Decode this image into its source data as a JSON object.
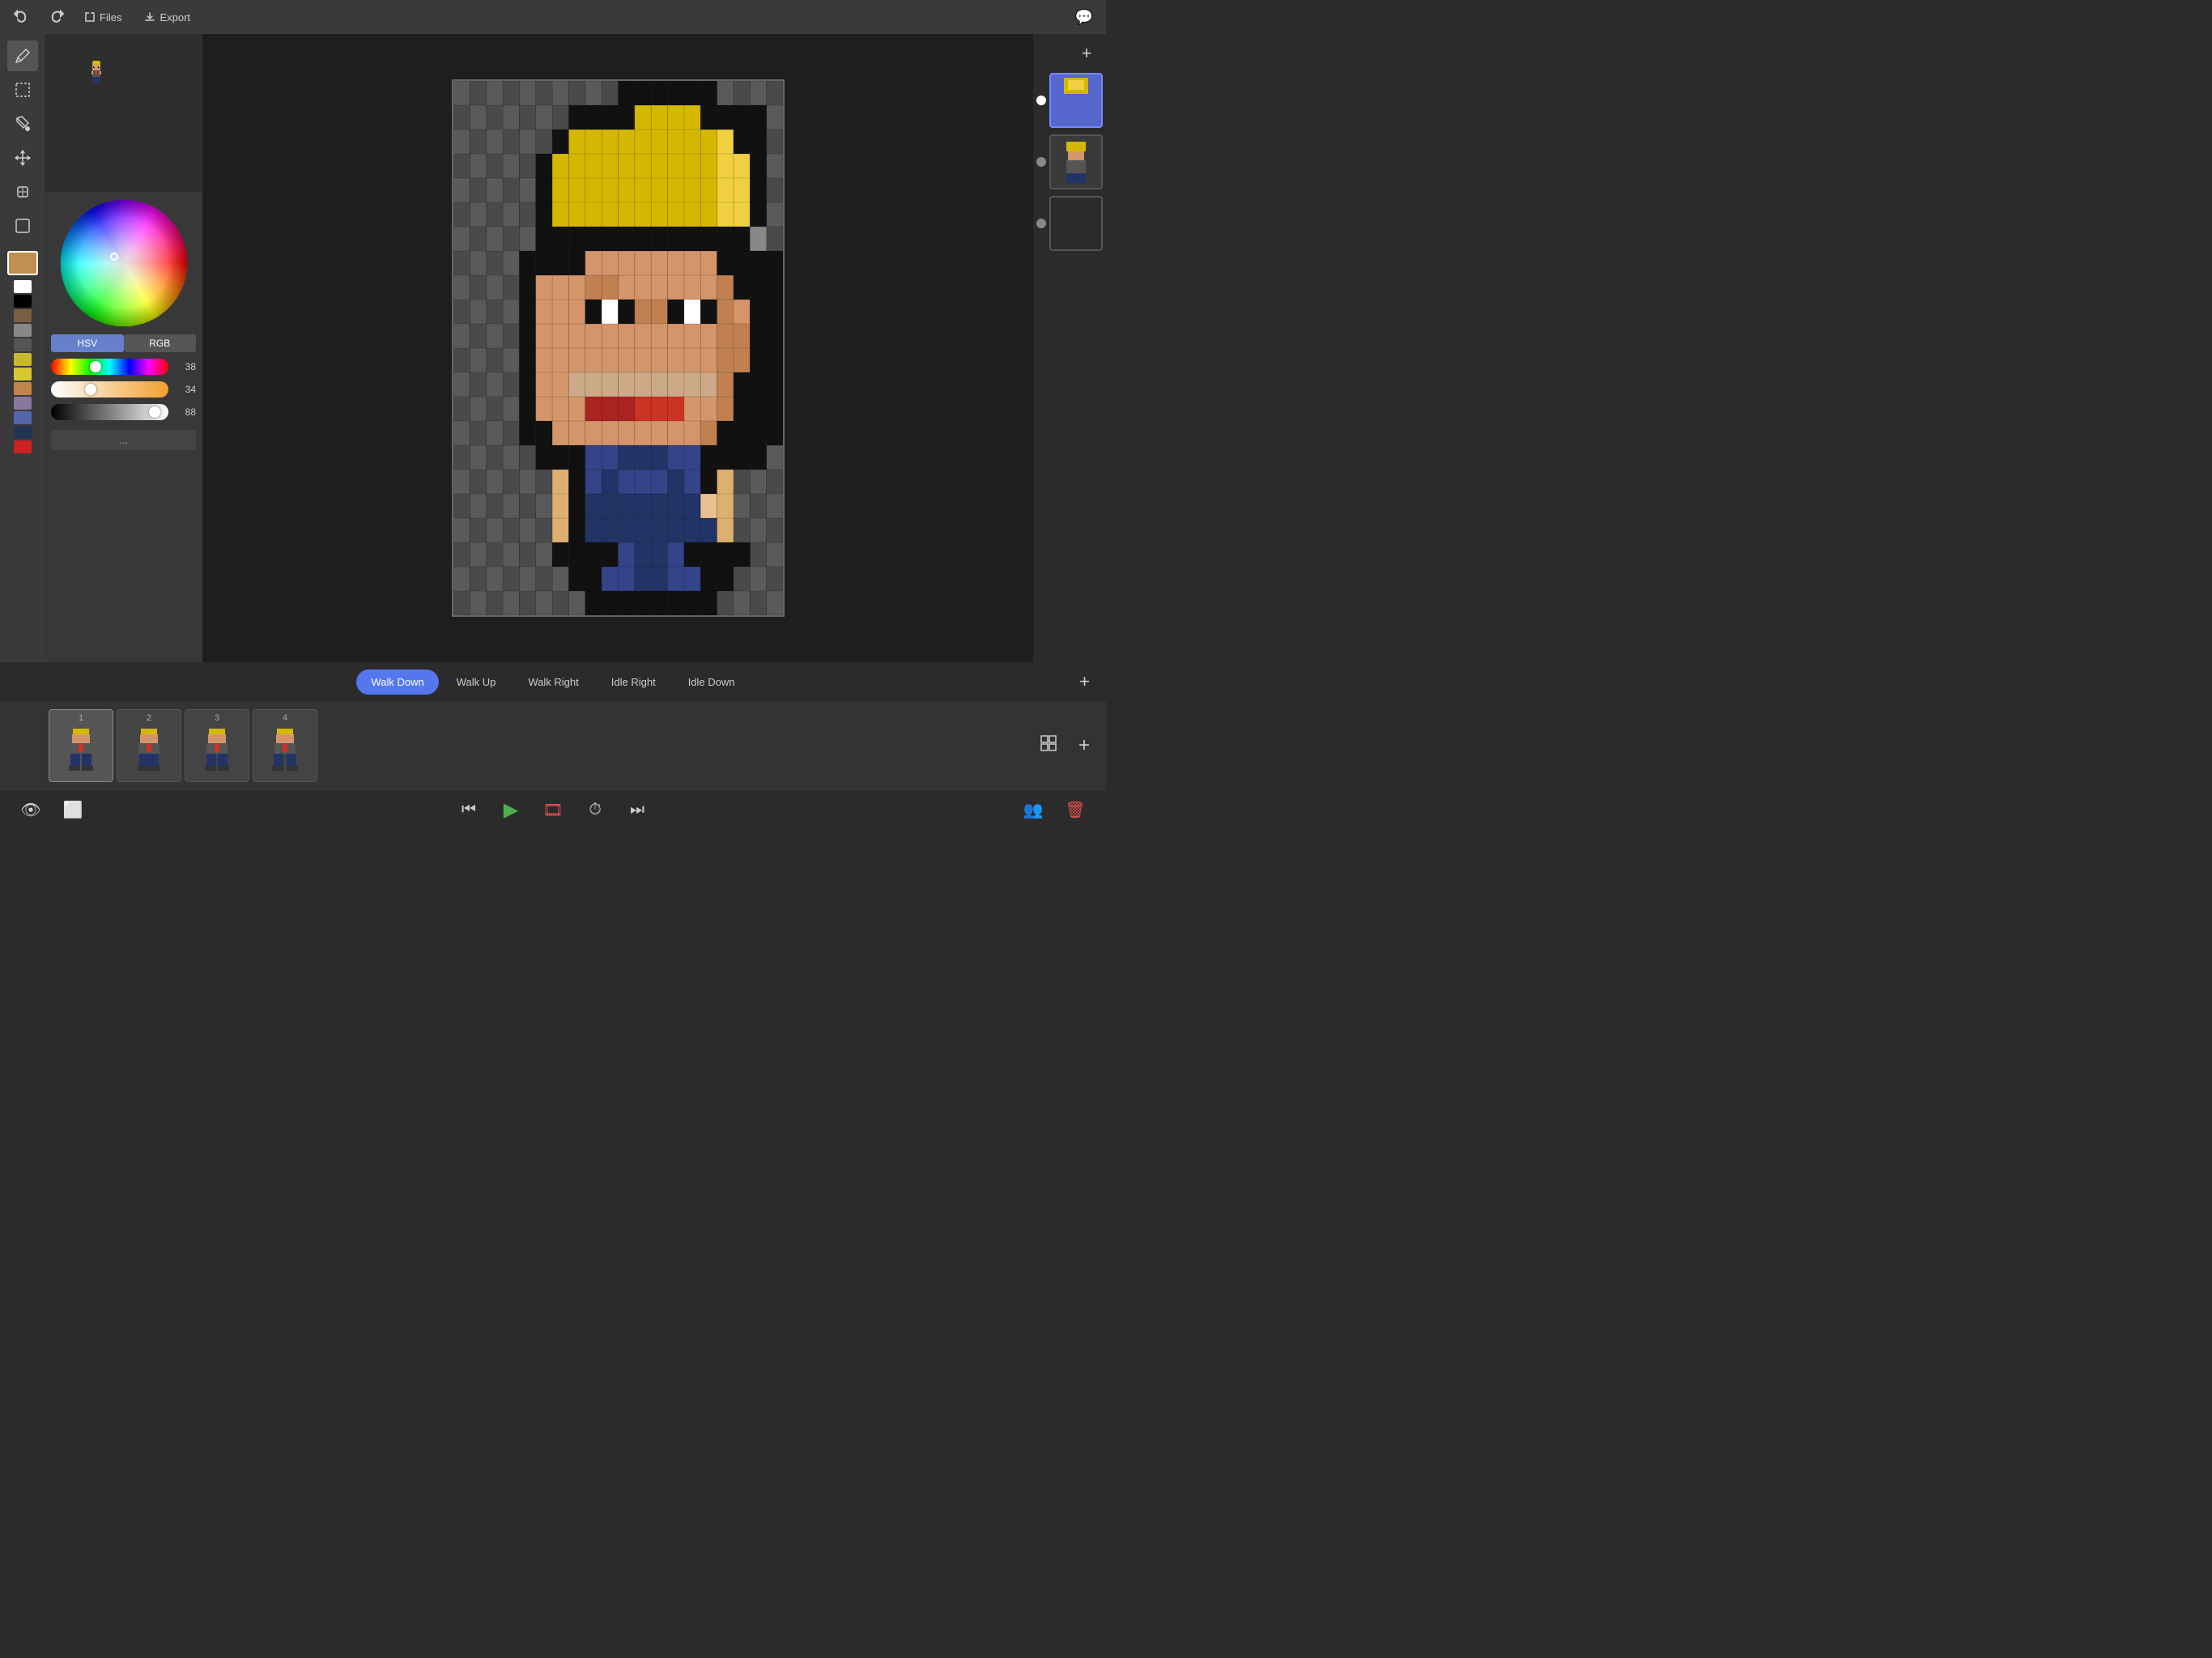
{
  "topBar": {
    "undoLabel": "↩",
    "redoLabel": "↪",
    "filesLabel": "Files",
    "exportLabel": "Export",
    "chatIcon": "💬",
    "addIcon": "+"
  },
  "tools": [
    {
      "name": "pencil",
      "icon": "✏️"
    },
    {
      "name": "select-rect",
      "icon": "▭"
    },
    {
      "name": "fill",
      "icon": "🪣"
    },
    {
      "name": "move",
      "icon": "✥"
    },
    {
      "name": "stamp",
      "icon": "⬡"
    },
    {
      "name": "select-lasso",
      "icon": "⬜"
    }
  ],
  "colorSwatches": [
    {
      "color": "#ffffff",
      "label": "white"
    },
    {
      "color": "#000000",
      "label": "black"
    },
    {
      "color": "#7a6040",
      "label": "brown"
    },
    {
      "color": "#888888",
      "label": "gray-mid"
    },
    {
      "color": "#555555",
      "label": "gray-dark"
    },
    {
      "color": "#c8b830",
      "label": "yellow-gold"
    },
    {
      "color": "#d8c830",
      "label": "yellow"
    },
    {
      "color": "#c0854a",
      "label": "tan"
    },
    {
      "color": "#8878a0",
      "label": "purple-gray"
    },
    {
      "color": "#5566aa",
      "label": "blue"
    },
    {
      "color": "#223355",
      "label": "navy"
    },
    {
      "color": "#cc2222",
      "label": "red"
    }
  ],
  "activeColor": "#c09050",
  "hsv": {
    "h": 38,
    "s": 34,
    "v": 88
  },
  "colorMode": "HSV",
  "animTabs": [
    {
      "label": "Walk Down",
      "active": true
    },
    {
      "label": "Walk Up",
      "active": false
    },
    {
      "label": "Walk Right",
      "active": false
    },
    {
      "label": "Idle Right",
      "active": false
    },
    {
      "label": "Idle Down",
      "active": false
    }
  ],
  "frames": [
    {
      "number": "1",
      "active": true
    },
    {
      "number": "2",
      "active": false
    },
    {
      "number": "3",
      "active": false
    },
    {
      "number": "4",
      "active": false
    }
  ],
  "layers": [
    {
      "active": true,
      "radio": true
    },
    {
      "active": false,
      "radio": false
    },
    {
      "active": false,
      "radio": false
    }
  ],
  "bottomBar": {
    "eyeIcon": "👁",
    "frameIcon": "⬜",
    "rewindIcon": "⏮",
    "playIcon": "▶",
    "filmIcon": "🎞",
    "clockIcon": "⏱",
    "fastForwardIcon": "⏭",
    "groupIcon": "👥",
    "deleteIcon": "🗑"
  },
  "moreLabel": "...",
  "addLayerLabel": "+",
  "addFrameLabel": "+",
  "addAnimLabel": "+"
}
